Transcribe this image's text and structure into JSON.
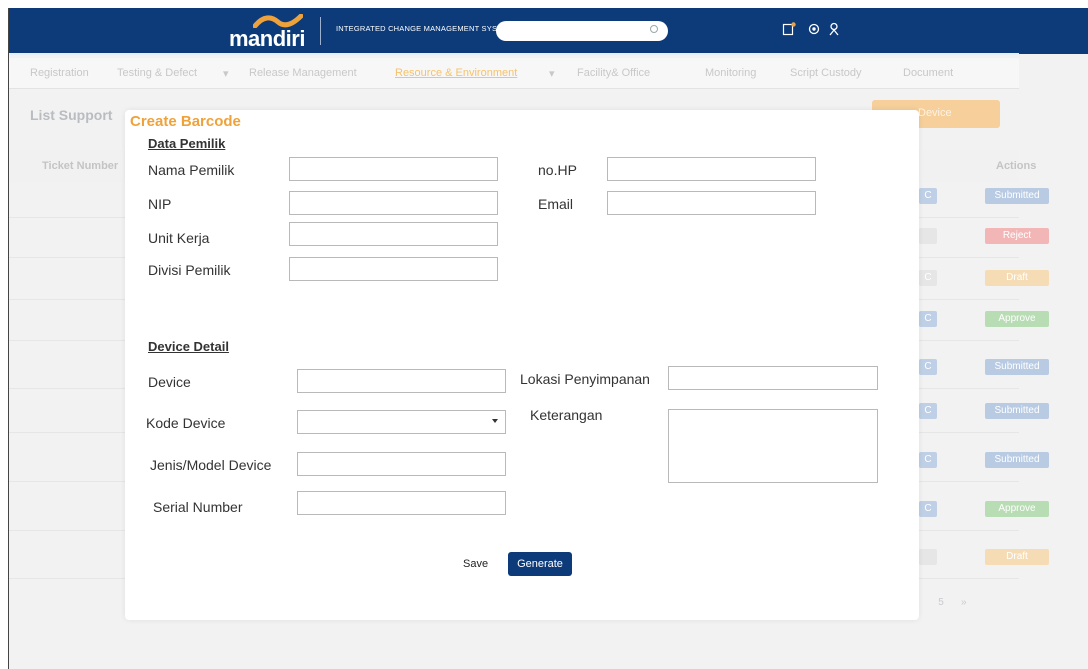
{
  "header": {
    "logo_text": "mandiri",
    "app_title": "INTEGRATED CHANGE MANAGEMENT SYSTEM",
    "search_placeholder": "",
    "icons": [
      "report-icon",
      "settings-icon",
      "user-icon"
    ],
    "colors": {
      "brand": "#0d3b7a",
      "logo_accent": "#f0a23a"
    }
  },
  "menu": {
    "items": [
      "Registration",
      "Testing & Defect",
      "Release Management",
      "Resource & Environment",
      "Facility& Office",
      "Monitoring",
      "Script Custody",
      "Document"
    ],
    "active": "Resource & Environment"
  },
  "page": {
    "title": "List Support",
    "add_button": "Device",
    "table_headers": {
      "ticket_number": "Ticket Number",
      "actions": "Actions"
    },
    "rows": [
      {
        "status": "Submitted",
        "type": "submitted",
        "chip": "blue",
        "chip_label": "C"
      },
      {
        "status": "Reject",
        "type": "reject",
        "chip": "grey",
        "chip_label": ""
      },
      {
        "status": "Draft",
        "type": "draft",
        "chip": "grey",
        "chip_label": "C"
      },
      {
        "status": "Approve",
        "type": "approve",
        "chip": "blue",
        "chip_label": "C"
      },
      {
        "status": "Submitted",
        "type": "submitted",
        "chip": "blue",
        "chip_label": "C"
      },
      {
        "status": "Submitted",
        "type": "submitted",
        "chip": "blue",
        "chip_label": "C"
      },
      {
        "status": "Submitted",
        "type": "submitted",
        "chip": "blue",
        "chip_label": "C"
      },
      {
        "status": "Approve",
        "type": "approve",
        "chip": "blue",
        "chip_label": "C"
      },
      {
        "status": "Draft",
        "type": "draft",
        "chip": "grey",
        "chip_label": ""
      }
    ],
    "pagination": [
      "5",
      "»"
    ]
  },
  "modal": {
    "title": "Create Barcode",
    "data_pemilik": {
      "section_title": "Data Pemilik",
      "nama_pemilik_label": "Nama Pemilik",
      "nip_label": "NIP",
      "unit_kerja_label": "Unit Kerja",
      "divisi_pemilik_label": "Divisi Pemilik",
      "no_hp_label": "no.HP",
      "email_label": "Email",
      "values": {
        "nama_pemilik": "",
        "nip": "",
        "unit_kerja": "",
        "divisi_pemilik": "",
        "no_hp": "",
        "email": ""
      }
    },
    "device_detail": {
      "section_title": "Device Detail",
      "device_label": "Device",
      "kode_device_label": "Kode Device",
      "jenis_model_label": "Jenis/Model Device",
      "serial_number_label": "Serial Number",
      "lokasi_label": "Lokasi Penyimpanan",
      "keterangan_label": "Keterangan",
      "values": {
        "device": "",
        "kode_device": "",
        "jenis_model": "",
        "serial_number": "",
        "lokasi": "",
        "keterangan": ""
      }
    },
    "save_label": "Save",
    "generate_label": "Generate"
  }
}
